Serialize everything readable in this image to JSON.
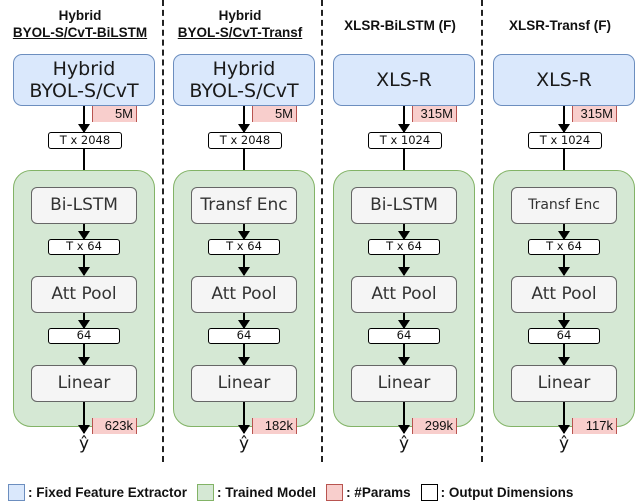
{
  "columns": [
    {
      "title_line1": "Hybrid",
      "title_line2": "BYOL-S/CvT-BiLSTM",
      "extractor": [
        "Hybrid",
        "BYOL-S/CvT"
      ],
      "extractor_params": "5M",
      "extractor_output": "T x 2048",
      "layer1": "Bi-LSTM",
      "layer1_output": "T x 64",
      "pool": "Att Pool",
      "pool_output": "64",
      "head": "Linear",
      "head_params": "623k",
      "output": "ŷ"
    },
    {
      "title_line1": "Hybrid",
      "title_line2": "BYOL-S/CvT-Transf",
      "extractor": [
        "Hybrid",
        "BYOL-S/CvT"
      ],
      "extractor_params": "5M",
      "extractor_output": "T x 2048",
      "layer1": "Transf Enc",
      "layer1_output": "T x 64",
      "pool": "Att Pool",
      "pool_output": "64",
      "head": "Linear",
      "head_params": "182k",
      "output": "ŷ"
    },
    {
      "title_line1": "",
      "title_line2": "XLSR-BiLSTM (F)",
      "extractor": [
        "XLS-R"
      ],
      "extractor_params": "315M",
      "extractor_output": "T x 1024",
      "layer1": "Bi-LSTM",
      "layer1_output": "T x 64",
      "pool": "Att Pool",
      "pool_output": "64",
      "head": "Linear",
      "head_params": "299k",
      "output": "ŷ"
    },
    {
      "title_line1": "",
      "title_line2": "XLSR-Transf (F)",
      "extractor": [
        "XLS-R"
      ],
      "extractor_params": "315M",
      "extractor_output": "T x 1024",
      "layer1": "Transf Enc",
      "layer1_output": "T x 64",
      "pool": "Att Pool",
      "pool_output": "64",
      "head": "Linear",
      "head_params": "117k",
      "output": "ŷ"
    }
  ],
  "legend": [
    {
      "label": ": Fixed Feature Extractor",
      "fill": "#dae8fc",
      "stroke": "#6c8ebf"
    },
    {
      "label": ": Trained Model",
      "fill": "#d5e8d4",
      "stroke": "#82b366"
    },
    {
      "label": ": #Params",
      "fill": "#f8cecc",
      "stroke": "#b85450"
    },
    {
      "label": ": Output Dimensions",
      "fill": "#ffffff",
      "stroke": "#000000"
    }
  ]
}
